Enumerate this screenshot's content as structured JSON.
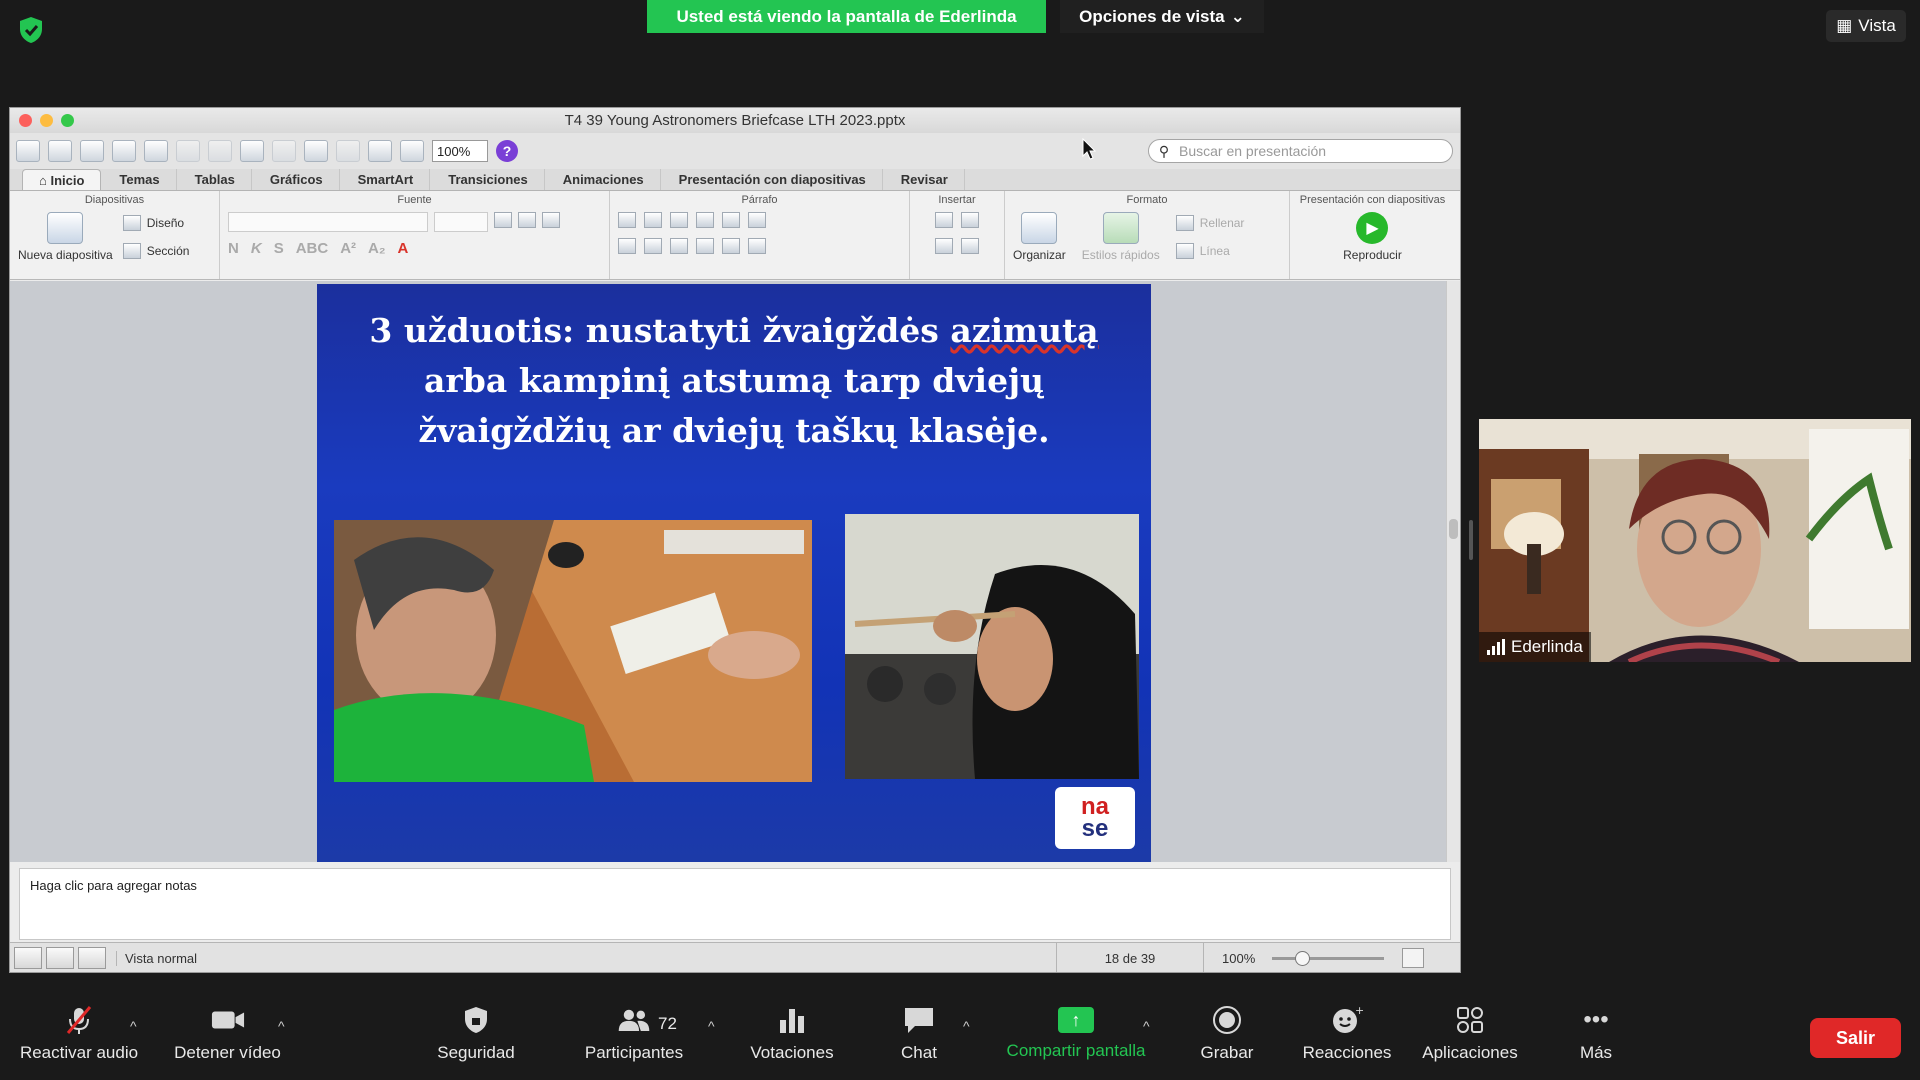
{
  "zoom_top": {
    "share_banner": "Usted está viendo la pantalla de Ederlinda",
    "view_options": "Opciones de vista",
    "view_button": "Vista"
  },
  "app": {
    "window_title": "T4 39 Young Astronomers Briefcase LTH 2023.pptx",
    "zoom_value": "100%",
    "search_placeholder": "Buscar en presentación",
    "tabs": [
      "Inicio",
      "Temas",
      "Tablas",
      "Gráficos",
      "SmartArt",
      "Transiciones",
      "Animaciones",
      "Presentación con diapositivas",
      "Revisar"
    ],
    "groups": {
      "diapositivas": "Diapositivas",
      "fuente": "Fuente",
      "parrafo": "Párrafo",
      "insertar": "Insertar",
      "formato": "Formato",
      "presentacion": "Presentación con diapositivas"
    },
    "buttons": {
      "new_slide": "Nueva diapositiva",
      "design": "Diseño",
      "section": "Sección",
      "organize": "Organizar",
      "quick_styles": "Estilos rápidos",
      "fill": "Rellenar",
      "line": "Línea",
      "play": "Reproducir"
    },
    "slide": {
      "title_part1": "3 užduotis: nustatyti žvaigždės ",
      "title_misspelled": "azimutą",
      "title_part2": " arba kampinį atstumą tarp dviejų žvaigždžių ar dviejų taškų klasėje.",
      "logo_line1": "na",
      "logo_line2": "se"
    },
    "notes_placeholder": "Haga clic para agregar notas",
    "status": {
      "view_name": "Vista normal",
      "page_count": "18 de 39",
      "zoom": "100%"
    }
  },
  "participant": {
    "name": "Ederlinda"
  },
  "controls": {
    "unmute": "Reactivar audio",
    "stop_video": "Detener vídeo",
    "security": "Seguridad",
    "participants": "Participantes",
    "participants_count": "72",
    "polls": "Votaciones",
    "chat": "Chat",
    "share_screen": "Compartir pantalla",
    "record": "Grabar",
    "reactions": "Reacciones",
    "apps": "Aplicaciones",
    "more": "Más",
    "leave": "Salir"
  },
  "colors": {
    "zoom_green": "#23c552",
    "leave_red": "#e02828",
    "slide_blue": "#1a3bbf"
  }
}
